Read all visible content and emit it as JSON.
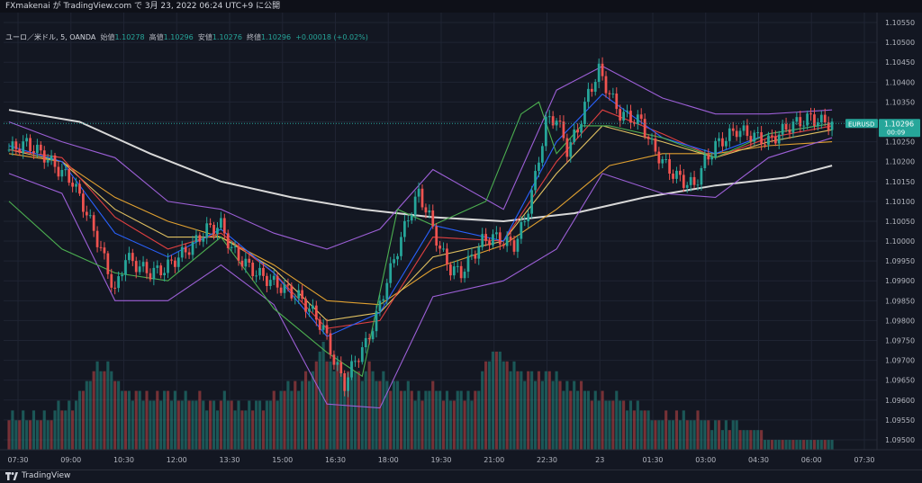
{
  "header": {
    "publisher_text": "FXmakenai が TradingView.com で 3月 23, 2022 06:24 UTC+9 に公開"
  },
  "legend": {
    "symbol": "ユーロ／米ドル, 5, OANDA",
    "open_label": "始値",
    "open_value": "1.10278",
    "high_label": "高値",
    "high_value": "1.10296",
    "low_label": "安値",
    "low_value": "1.10276",
    "close_label": "終値",
    "close_value": "1.10296",
    "change": "+0.00018 (+0.02%)"
  },
  "footer": {
    "brand": "TradingView",
    "logo_icon": "tradingview-logo-icon"
  },
  "colors": {
    "background": "#131722",
    "grid": "#1f2433",
    "up": "#26a69a",
    "down": "#ef5350",
    "price_tag": "#26a69a"
  },
  "chart_data": {
    "type": "candlestick",
    "symbol_tag": "EURUSD",
    "last_price": "1.10296",
    "countdown": "00:09",
    "y_ticks": [
      "1.10550",
      "1.10500",
      "1.10450",
      "1.10400",
      "1.10350",
      "1.10300",
      "1.10250",
      "1.10200",
      "1.10150",
      "1.10100",
      "1.10050",
      "1.10000",
      "1.09950",
      "1.09900",
      "1.09850",
      "1.09800",
      "1.09750",
      "1.09700",
      "1.09650",
      "1.09600",
      "1.09550",
      "1.09500"
    ],
    "x_ticks": [
      "07:30",
      "09:00",
      "10:30",
      "12:00",
      "13:30",
      "15:00",
      "16:30",
      "18:00",
      "19:30",
      "21:00",
      "22:30",
      "23",
      "01:30",
      "03:00",
      "04:30",
      "06:00",
      "07:30"
    ],
    "ylim": [
      1.09475,
      1.10575
    ],
    "price_path": [
      [
        0,
        1.1023
      ],
      [
        5,
        1.10245
      ],
      [
        10,
        1.10215
      ],
      [
        14,
        1.1018
      ],
      [
        18,
        1.1015
      ],
      [
        22,
        1.1007
      ],
      [
        26,
        1.0998
      ],
      [
        30,
        1.0987
      ],
      [
        33,
        1.0996
      ],
      [
        36,
        1.0994
      ],
      [
        40,
        1.0992
      ],
      [
        44,
        1.0993
      ],
      [
        48,
        1.0996
      ],
      [
        52,
        1.0999
      ],
      [
        56,
        1.1003
      ],
      [
        60,
        1.1004
      ],
      [
        63,
        1.0998
      ],
      [
        66,
        1.0995
      ],
      [
        70,
        1.0992
      ],
      [
        74,
        1.099
      ],
      [
        78,
        1.0988
      ],
      [
        82,
        1.0986
      ],
      [
        86,
        1.0982
      ],
      [
        89,
        1.0978
      ],
      [
        92,
        1.097
      ],
      [
        95,
        1.0964
      ],
      [
        98,
        1.097
      ],
      [
        101,
        1.0974
      ],
      [
        104,
        1.0981
      ],
      [
        107,
        1.099
      ],
      [
        110,
        1.0998
      ],
      [
        113,
        1.1006
      ],
      [
        116,
        1.1012
      ],
      [
        119,
        1.1006
      ],
      [
        122,
        1.0998
      ],
      [
        125,
        1.0993
      ],
      [
        128,
        1.0992
      ],
      [
        131,
        1.0996
      ],
      [
        134,
        1.1
      ],
      [
        137,
        1.1001
      ],
      [
        140,
        1.1
      ],
      [
        143,
        1.0999
      ],
      [
        146,
        1.1005
      ],
      [
        149,
        1.1016
      ],
      [
        152,
        1.103
      ],
      [
        155,
        1.1031
      ],
      [
        158,
        1.1023
      ],
      [
        161,
        1.1028
      ],
      [
        164,
        1.1037
      ],
      [
        167,
        1.1043
      ],
      [
        170,
        1.1037
      ],
      [
        173,
        1.1032
      ],
      [
        176,
        1.1031
      ],
      [
        179,
        1.103
      ],
      [
        182,
        1.1024
      ],
      [
        185,
        1.102
      ],
      [
        188,
        1.1017
      ],
      [
        191,
        1.1015
      ],
      [
        194,
        1.1014
      ],
      [
        197,
        1.102
      ],
      [
        200,
        1.1024
      ],
      [
        203,
        1.1026
      ],
      [
        206,
        1.1028
      ],
      [
        209,
        1.1027
      ],
      [
        212,
        1.1026
      ],
      [
        215,
        1.1025
      ],
      [
        218,
        1.1027
      ],
      [
        221,
        1.1029
      ],
      [
        224,
        1.103
      ],
      [
        227,
        1.1031
      ],
      [
        230,
        1.103
      ],
      [
        233,
        1.10296
      ]
    ],
    "overlays": [
      {
        "color": "#d8d8d8",
        "points": [
          [
            0,
            1.1033
          ],
          [
            20,
            1.103
          ],
          [
            40,
            1.1022
          ],
          [
            60,
            1.1015
          ],
          [
            80,
            1.1011
          ],
          [
            100,
            1.1008
          ],
          [
            120,
            1.1006
          ],
          [
            140,
            1.1005
          ],
          [
            160,
            1.1007
          ],
          [
            180,
            1.1011
          ],
          [
            200,
            1.1014
          ],
          [
            220,
            1.1016
          ],
          [
            233,
            1.1019
          ]
        ]
      },
      {
        "color": "#e0a030",
        "points": [
          [
            0,
            1.1022
          ],
          [
            15,
            1.102
          ],
          [
            30,
            1.1011
          ],
          [
            45,
            1.1005
          ],
          [
            60,
            1.1001
          ],
          [
            75,
            1.0994
          ],
          [
            90,
            1.0985
          ],
          [
            105,
            1.0984
          ],
          [
            120,
            1.0993
          ],
          [
            140,
            1.0999
          ],
          [
            155,
            1.1008
          ],
          [
            170,
            1.1019
          ],
          [
            185,
            1.1022
          ],
          [
            200,
            1.1022
          ],
          [
            215,
            1.1024
          ],
          [
            233,
            1.1025
          ]
        ]
      },
      {
        "color": "#e0c060",
        "points": [
          [
            0,
            1.1023
          ],
          [
            15,
            1.102
          ],
          [
            30,
            1.1008
          ],
          [
            45,
            1.1001
          ],
          [
            60,
            1.1001
          ],
          [
            75,
            1.0993
          ],
          [
            90,
            1.098
          ],
          [
            105,
            1.0982
          ],
          [
            120,
            1.0996
          ],
          [
            140,
            1.1
          ],
          [
            155,
            1.1017
          ],
          [
            168,
            1.1029
          ],
          [
            185,
            1.1025
          ],
          [
            200,
            1.1021
          ],
          [
            215,
            1.1025
          ],
          [
            233,
            1.1028
          ]
        ]
      },
      {
        "color": "#e04040",
        "points": [
          [
            0,
            1.1023
          ],
          [
            15,
            1.1021
          ],
          [
            30,
            1.1006
          ],
          [
            45,
            1.0998
          ],
          [
            60,
            1.1002
          ],
          [
            75,
            1.0992
          ],
          [
            90,
            1.0978
          ],
          [
            105,
            1.098
          ],
          [
            120,
            1.1001
          ],
          [
            140,
            1.1
          ],
          [
            155,
            1.102
          ],
          [
            168,
            1.1033
          ],
          [
            185,
            1.1027
          ],
          [
            200,
            1.1021
          ],
          [
            215,
            1.1026
          ],
          [
            233,
            1.1029
          ]
        ]
      },
      {
        "color": "#2962ff",
        "points": [
          [
            0,
            1.1024
          ],
          [
            15,
            1.102
          ],
          [
            30,
            1.1002
          ],
          [
            45,
            1.0996
          ],
          [
            60,
            1.1003
          ],
          [
            75,
            1.0992
          ],
          [
            90,
            1.0976
          ],
          [
            105,
            1.0982
          ],
          [
            120,
            1.1004
          ],
          [
            140,
            1.1
          ],
          [
            155,
            1.1025
          ],
          [
            168,
            1.1037
          ],
          [
            185,
            1.1026
          ],
          [
            200,
            1.1022
          ],
          [
            215,
            1.1027
          ],
          [
            233,
            1.10296
          ]
        ]
      },
      {
        "color": "#9c5fd6",
        "points": [
          [
            0,
            1.103
          ],
          [
            15,
            1.1025
          ],
          [
            30,
            1.1021
          ],
          [
            45,
            1.101
          ],
          [
            60,
            1.1008
          ],
          [
            75,
            1.1002
          ],
          [
            90,
            1.0998
          ],
          [
            105,
            1.1003
          ],
          [
            120,
            1.1018
          ],
          [
            140,
            1.1008
          ],
          [
            155,
            1.1038
          ],
          [
            168,
            1.1044
          ],
          [
            185,
            1.1036
          ],
          [
            200,
            1.1032
          ],
          [
            215,
            1.1032
          ],
          [
            233,
            1.1033
          ]
        ]
      },
      {
        "color": "#9c5fd6",
        "points": [
          [
            0,
            1.1017
          ],
          [
            15,
            1.1012
          ],
          [
            30,
            1.0985
          ],
          [
            45,
            1.0985
          ],
          [
            60,
            1.0994
          ],
          [
            75,
            1.0984
          ],
          [
            90,
            1.0959
          ],
          [
            105,
            1.0958
          ],
          [
            120,
            1.0986
          ],
          [
            140,
            1.099
          ],
          [
            155,
            1.0998
          ],
          [
            168,
            1.1017
          ],
          [
            185,
            1.1012
          ],
          [
            200,
            1.1011
          ],
          [
            215,
            1.1021
          ],
          [
            233,
            1.1026
          ]
        ]
      },
      {
        "color": "#4caf50",
        "points": [
          [
            0,
            1.101
          ],
          [
            15,
            1.0998
          ],
          [
            30,
            1.0992
          ],
          [
            45,
            1.099
          ],
          [
            60,
            1.1001
          ],
          [
            75,
            1.0983
          ],
          [
            90,
            1.0972
          ],
          [
            100,
            1.0966
          ],
          [
            110,
            1.1008
          ],
          [
            120,
            1.1004
          ],
          [
            135,
            1.101
          ],
          [
            145,
            1.1032
          ],
          [
            150,
            1.1035
          ],
          [
            155,
            1.1022
          ],
          [
            162,
            1.1029
          ],
          [
            170,
            1.1029
          ],
          [
            185,
            1.1026
          ],
          [
            200,
            1.1021
          ],
          [
            215,
            1.1027
          ],
          [
            233,
            1.10296
          ]
        ]
      }
    ],
    "volume": [
      3,
      4,
      3,
      3,
      4,
      3,
      3,
      4,
      3,
      3,
      4,
      3,
      3,
      4,
      5,
      4,
      4,
      5,
      4,
      5,
      6,
      6,
      7,
      7,
      8,
      9,
      8,
      8,
      9,
      8,
      7,
      7,
      6,
      6,
      6,
      5,
      6,
      6,
      5,
      6,
      5,
      5,
      6,
      5,
      6,
      6,
      5,
      6,
      5,
      5,
      6,
      5,
      5,
      5,
      6,
      5,
      4,
      5,
      5,
      4,
      5,
      6,
      5,
      5,
      4,
      5,
      4,
      4,
      5,
      4,
      5,
      5,
      4,
      5,
      5,
      6,
      5,
      6,
      6,
      7,
      6,
      7,
      6,
      7,
      8,
      7,
      8,
      9,
      10,
      11,
      9,
      9,
      8,
      9,
      8,
      7,
      8,
      9,
      8,
      8,
      7,
      8,
      9,
      8,
      7,
      7,
      8,
      7,
      6,
      7,
      7,
      6,
      6,
      7,
      6,
      5,
      6,
      5,
      6,
      6,
      7,
      6,
      6,
      5,
      6,
      5,
      5,
      6,
      6,
      5,
      6,
      5,
      6,
      6,
      8,
      9,
      9,
      10,
      10,
      10,
      9,
      9,
      8,
      9,
      8,
      8,
      7,
      8,
      8,
      7,
      8,
      7,
      8,
      8,
      7,
      8,
      7,
      6,
      7,
      6,
      7,
      6,
      7,
      6,
      6,
      5,
      6,
      5,
      6,
      5,
      5,
      5,
      6,
      5,
      5,
      4,
      5,
      4,
      5,
      4,
      4,
      4,
      3,
      3,
      3,
      3,
      4,
      3,
      3,
      4,
      3,
      4,
      3,
      3,
      3,
      4,
      3,
      3,
      3,
      2,
      3,
      3,
      2,
      3,
      2,
      3,
      3,
      2,
      2,
      2,
      2,
      2,
      2,
      2,
      1,
      1,
      1,
      1,
      1,
      1,
      1,
      1,
      1,
      1,
      1,
      1,
      1,
      1,
      1,
      1,
      1,
      1,
      1,
      1
    ]
  }
}
